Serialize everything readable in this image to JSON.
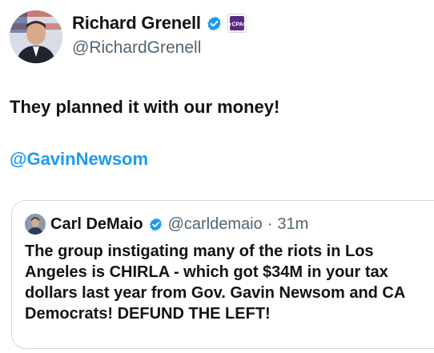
{
  "author": {
    "name": "Richard Grenell",
    "handle": "@RichardGrenell",
    "org_badge_text": "★CPAC"
  },
  "tweet": {
    "text": "They planned it with our money!",
    "mention": "@GavinNewsom"
  },
  "quoted": {
    "name": "Carl DeMaio",
    "handle": "@carldemaio",
    "separator": "·",
    "time": "31m",
    "text": "The group instigating many of the riots in Los Angeles is CHIRLA - which got $34M in your tax dollars last year from Gov. Gavin Newsom and CA Democrats! DEFUND THE LEFT!"
  },
  "colors": {
    "link": "#1d9bf0",
    "verified": "#1d9bf0",
    "secondary_text": "#536471",
    "badge": "#5b2a86"
  },
  "icons": {
    "verified": "verified-badge-icon",
    "org": "cpac-badge-icon"
  }
}
